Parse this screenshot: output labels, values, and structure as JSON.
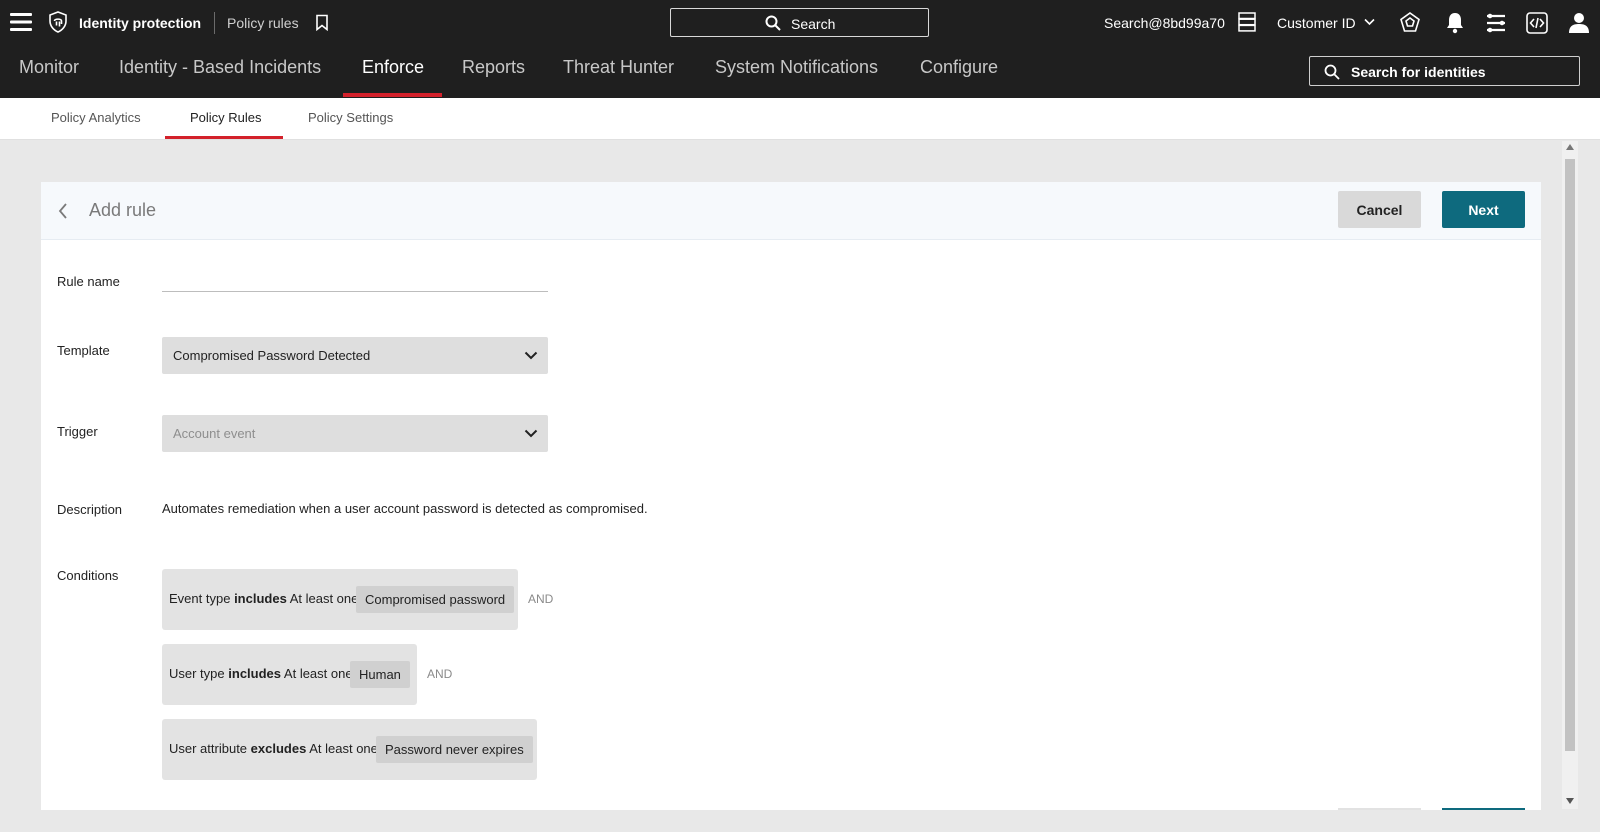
{
  "topbar": {
    "app_title": "Identity protection",
    "breadcrumb": "Policy rules",
    "search_label": "Search",
    "account": "Search@8bd99a70",
    "customer_label": "Customer ID",
    "icons": [
      "menu-icon",
      "fingerprint-shield-icon",
      "bookmark-icon",
      "search-icon",
      "server-icon",
      "chevron-down-icon",
      "badge-icon",
      "bell-icon",
      "stack-icon",
      "code-icon",
      "user-icon"
    ]
  },
  "nav": {
    "items": [
      "Monitor",
      "Identity - Based Incidents",
      "Enforce",
      "Reports",
      "Threat Hunter",
      "System Notifications",
      "Configure"
    ],
    "active": "Enforce",
    "identity_search_label": "Search for identities"
  },
  "subtabs": {
    "items": [
      "Policy Analytics",
      "Policy Rules",
      "Policy Settings"
    ],
    "active": "Policy Rules"
  },
  "card": {
    "title": "Add rule",
    "cancel_label": "Cancel",
    "next_label": "Next"
  },
  "form": {
    "rule_name_label": "Rule name",
    "rule_name_value": "",
    "template_label": "Template",
    "template_value": "Compromised Password Detected",
    "trigger_label": "Trigger",
    "trigger_value": "Account event",
    "description_label": "Description",
    "description_value": "Automates remediation when a user account password is detected as compromised.",
    "conditions_label": "Conditions"
  },
  "conditions": [
    {
      "field": "Event type",
      "operator": "includes",
      "quantifier": "At least one",
      "value": "Compromised password",
      "joiner": "AND"
    },
    {
      "field": "User type",
      "operator": "includes",
      "quantifier": "At least one",
      "value": "Human",
      "joiner": "AND"
    },
    {
      "field": "User attribute",
      "operator": "excludes",
      "quantifier": "At least one",
      "value": "Password never expires",
      "joiner": ""
    }
  ],
  "colors": {
    "topbar_bg": "#1f1f1f",
    "accent_red": "#d3212b",
    "primary_teal": "#0e6a7e",
    "page_bg": "#e8e8e8"
  }
}
